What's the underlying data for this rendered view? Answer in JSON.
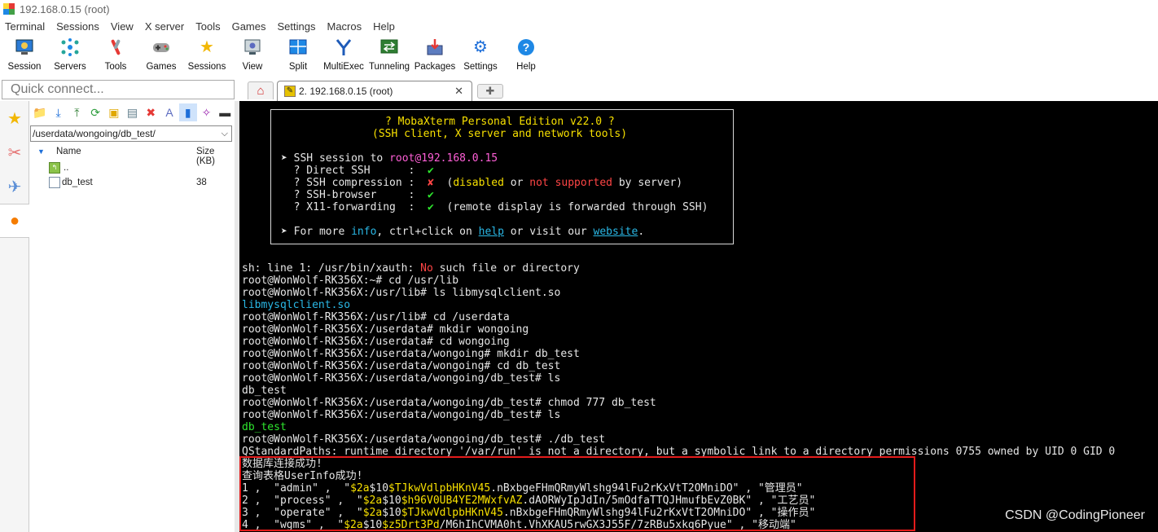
{
  "window": {
    "title": "192.168.0.15 (root)"
  },
  "menu": [
    "Terminal",
    "Sessions",
    "View",
    "X server",
    "Tools",
    "Games",
    "Settings",
    "Macros",
    "Help"
  ],
  "toolbar": [
    {
      "label": "Session",
      "icon": "session-icon"
    },
    {
      "label": "Servers",
      "icon": "servers-icon"
    },
    {
      "label": "Tools",
      "icon": "tools-icon"
    },
    {
      "label": "Games",
      "icon": "games-icon"
    },
    {
      "label": "Sessions",
      "icon": "star-icon"
    },
    {
      "label": "View",
      "icon": "view-icon"
    },
    {
      "label": "Split",
      "icon": "split-icon"
    },
    {
      "label": "MultiExec",
      "icon": "multiexec-icon"
    },
    {
      "label": "Tunneling",
      "icon": "tunneling-icon"
    },
    {
      "label": "Packages",
      "icon": "packages-icon"
    },
    {
      "label": "Settings",
      "icon": "settings-icon"
    },
    {
      "label": "Help",
      "icon": "help-icon"
    }
  ],
  "quick_connect": {
    "placeholder": "Quick connect..."
  },
  "tabs": {
    "session_label": "2. 192.168.0.15 (root)"
  },
  "file_browser": {
    "path": "/userdata/wongoing/db_test/",
    "columns": {
      "name": "Name",
      "size": "Size (KB)"
    },
    "rows": [
      {
        "name": "..",
        "size": ""
      },
      {
        "name": "db_test",
        "size": "38"
      }
    ]
  },
  "banner": {
    "line1": "? MobaXterm Personal Edition v22.0 ?",
    "line2": "(SSH client, X server and network tools)",
    "ssh_prefix": "➤ SSH session to ",
    "ssh_target": "root@192.168.0.15",
    "direct_ssh": "  ? Direct SSH      :  ",
    "ssh_compression": "  ? SSH compression :  ",
    "ssh_browser": "  ? SSH-browser     :  ",
    "x11": "  ? X11-forwarding  :  ",
    "check": "✔",
    "cross": "✘",
    "comp_open": "  (",
    "comp_disabled": "disabled",
    "comp_or": " or ",
    "comp_not": "not supported",
    "comp_end": " by server)",
    "x11_note": "  (remote display is forwarded through SSH)",
    "more_a": "➤ For more ",
    "more_info": "info",
    "more_b": ", ctrl+click on ",
    "more_help": "help",
    "more_c": " or visit our ",
    "more_site": "website",
    "more_d": "."
  },
  "terminal": {
    "l1a": "sh: line 1: /usr/bin/xauth: ",
    "l1b": "No",
    "l1c": " such file or directory",
    "l2": "root@WonWolf-RK356X:~# cd /usr/lib",
    "l3": "root@WonWolf-RK356X:/usr/lib# ls libmysqlclient.so",
    "l4": "libmysqlclient.so",
    "l5": "root@WonWolf-RK356X:/usr/lib# cd /userdata",
    "l6": "root@WonWolf-RK356X:/userdata# mkdir wongoing",
    "l7": "root@WonWolf-RK356X:/userdata# cd wongoing",
    "l8": "root@WonWolf-RK356X:/userdata/wongoing# mkdir db_test",
    "l9": "root@WonWolf-RK356X:/userdata/wongoing# cd db_test",
    "l10": "root@WonWolf-RK356X:/userdata/wongoing/db_test# ls",
    "l11": "db_test",
    "l12": "root@WonWolf-RK356X:/userdata/wongoing/db_test# chmod 777 db_test",
    "l13": "root@WonWolf-RK356X:/userdata/wongoing/db_test# ls",
    "l14": "db_test",
    "l15": "root@WonWolf-RK356X:/userdata/wongoing/db_test# ./db_test",
    "l16": "QStandardPaths: runtime directory '/var/run' is not a directory, but a symbolic link to a directory permissions 0755 owned by UID 0 GID 0",
    "l17": "数据库连接成功!",
    "l18": "查询表格UserInfo成功!",
    "rows": [
      {
        "a": "1 ,  \"admin\" ,  \"",
        "h1": "$2a",
        "h2": "$10",
        "h3": "$TJkwVdlpbHKnV45",
        "h4": ".nBxbgeFHmQRmyWlshg94lFu2rKxVtT2OMniDO\" , \"管理员\""
      },
      {
        "a": "2 ,  \"process\" ,  \"",
        "h1": "$2a",
        "h2": "$10",
        "h3": "$h96V0UB4YE2MWxfvAZ",
        "h4": ".dAORWyIpJdIn/5mOdfaTTQJHmufbEvZ0BK\" , \"工艺员\""
      },
      {
        "a": "3 ,  \"operate\" ,  \"",
        "h1": "$2a",
        "h2": "$10",
        "h3": "$TJkwVdlpbHKnV45",
        "h4": ".nBxbgeFHmQRmyWlshg94lFu2rKxVtT2OMniDO\" , \"操作员\""
      },
      {
        "a": "4 ,  \"wgms\" ,  \"",
        "h1": "$2a",
        "h2": "$10",
        "h3": "$z5Drt3Pd",
        "h4": "/M6hIhCVMA0ht.VhXKAU5rwGX3J55F/7zRBu5xkq6Pyue\" , \"移动端\""
      }
    ]
  },
  "watermark": "CSDN @CodingPioneer",
  "colors": {
    "terminal_bg": "#000000",
    "highlight": "#e31b1b",
    "prompt_dir": "#2ab8e6"
  }
}
